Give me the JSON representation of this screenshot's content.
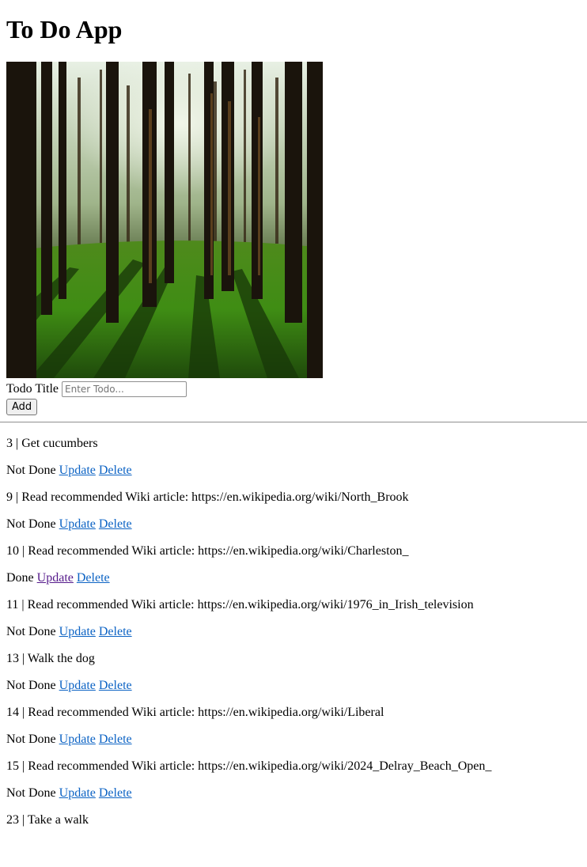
{
  "page": {
    "title": "To Do App",
    "hero_image": "forest-photo"
  },
  "form": {
    "label": "Todo Title",
    "placeholder": "Enter Todo...",
    "value": "",
    "add_label": "Add"
  },
  "todos": [
    {
      "id": "3",
      "title": "Get cucumbers",
      "status": "Not Done",
      "update": "Update",
      "delete": "Delete"
    },
    {
      "id": "9",
      "title": "Read recommended Wiki article: https://en.wikipedia.org/wiki/North_Brook",
      "status": "Not Done",
      "update": "Update",
      "delete": "Delete"
    },
    {
      "id": "10",
      "title": "Read recommended Wiki article: https://en.wikipedia.org/wiki/Charleston_",
      "status": "Done",
      "update": "Update",
      "delete": "Delete"
    },
    {
      "id": "11",
      "title": "Read recommended Wiki article: https://en.wikipedia.org/wiki/1976_in_Irish_television",
      "status": "Not Done",
      "update": "Update",
      "delete": "Delete"
    },
    {
      "id": "13",
      "title": "Walk the dog",
      "status": "Not Done",
      "update": "Update",
      "delete": "Delete"
    },
    {
      "id": "14",
      "title": "Read recommended Wiki article: https://en.wikipedia.org/wiki/Liberal",
      "status": "Not Done",
      "update": "Update",
      "delete": "Delete"
    },
    {
      "id": "15",
      "title": "Read recommended Wiki article: https://en.wikipedia.org/wiki/2024_Delray_Beach_Open_",
      "status": "Not Done",
      "update": "Update",
      "delete": "Delete"
    },
    {
      "id": "23",
      "title": "Take a walk",
      "status": "",
      "update": "",
      "delete": ""
    }
  ],
  "colors": {
    "link": "#0c63c4",
    "visited_link": "#551a8b"
  }
}
